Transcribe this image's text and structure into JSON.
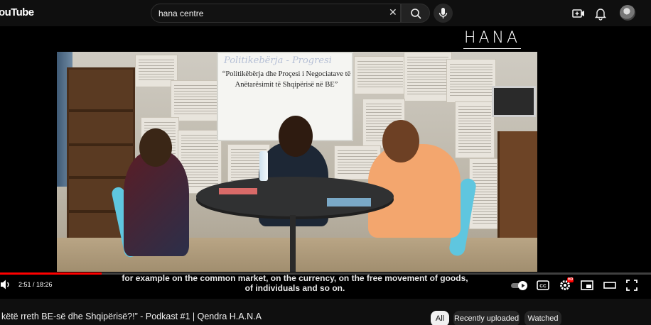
{
  "header": {
    "logo_text": "ouTube",
    "search": {
      "value": "hana centre",
      "clear_symbol": "✕"
    }
  },
  "player": {
    "brand_logo": "HANA",
    "whiteboard": {
      "handwritten": "Politikebërja - Progresi",
      "quote": "“Politikëbërja dhe Proçesi i Negociatave të Anëtarësimit të Shqipërisë në BE”"
    },
    "progress": {
      "played_fraction": 0.1556,
      "loaded_fraction": 0.15
    },
    "time_display": "2:51 / 18:26",
    "subtitle_lines": [
      "for example on the common market, on the currency, on the free movement of goods,",
      "of individuals and so on."
    ],
    "settings_badge": "HD",
    "accent_color": "#ff0000"
  },
  "video_title": "këtë rreth BE-së dhe Shqipërisë?!” - Podkast #1 | Qendra H.A.N.A",
  "chips": [
    {
      "label": "All",
      "active": true
    },
    {
      "label": "Recently uploaded",
      "active": false
    },
    {
      "label": "Watched",
      "active": false
    }
  ]
}
